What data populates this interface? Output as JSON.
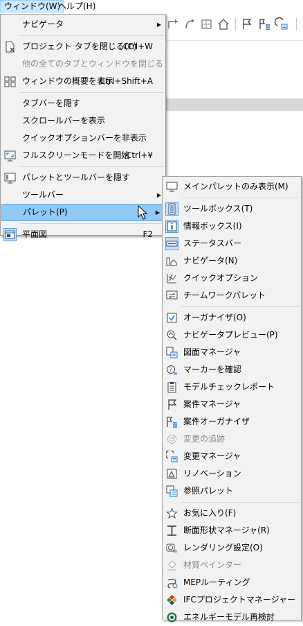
{
  "menubar": {
    "window": "ウィンドウ(W)",
    "help": "ヘルプ(H)"
  },
  "window_menu": {
    "items": [
      {
        "label": "ナビゲータ"
      },
      {
        "label": "プロジェクト タブを閉じる(C)",
        "shortcut": "Ctrl+W"
      },
      {
        "label": "他の全てのタブとウィンドウを閉じる"
      },
      {
        "label": "ウィンドウの概要を表示",
        "shortcut": "Ctrl+Shift+A"
      },
      {
        "label": "タブバーを隠す"
      },
      {
        "label": "スクロールバーを表示"
      },
      {
        "label": "クイックオプションバーを非表示"
      },
      {
        "label": "フルスクリーンモードを開始",
        "shortcut": "Ctrl+¥"
      },
      {
        "label": "パレットとツールバーを隠す"
      },
      {
        "label": "ツールバー"
      },
      {
        "label": "パレット(P)"
      },
      {
        "label": "平面図",
        "shortcut": "F2"
      }
    ]
  },
  "palette_menu": {
    "items": [
      {
        "label": "メインパレットのみ表示(M)"
      },
      {
        "label": "ツールボックス(T)"
      },
      {
        "label": "情報ボックス(I)"
      },
      {
        "label": "ステータスバー"
      },
      {
        "label": "ナビゲータ(N)"
      },
      {
        "label": "クイックオプション"
      },
      {
        "label": "チームワークパレット"
      },
      {
        "label": "オーガナイザ(O)"
      },
      {
        "label": "ナビゲータプレビュー(P)"
      },
      {
        "label": "図面マネージャ"
      },
      {
        "label": "マーカーを確認"
      },
      {
        "label": "モデルチェックレポート"
      },
      {
        "label": "案件マネージャ"
      },
      {
        "label": "案件オーガナイザ"
      },
      {
        "label": "変更の追跡"
      },
      {
        "label": "変更マネージャ"
      },
      {
        "label": "リノベーション"
      },
      {
        "label": "参照パレット"
      },
      {
        "label": "お気に入り(F)"
      },
      {
        "label": "断面形状マネージャ(R)"
      },
      {
        "label": "レンダリング設定(O)"
      },
      {
        "label": "材質ペインター"
      },
      {
        "label": "MEPルーティング"
      },
      {
        "label": "IFCプロジェクトマネージャー"
      },
      {
        "label": "エネルギーモデル再検討"
      }
    ]
  },
  "colors": {
    "highlight": "#91c9f7",
    "menubar_active": "#cce8ff",
    "menu_bg": "#f2f2f2",
    "disabled": "#8a8a8a"
  }
}
